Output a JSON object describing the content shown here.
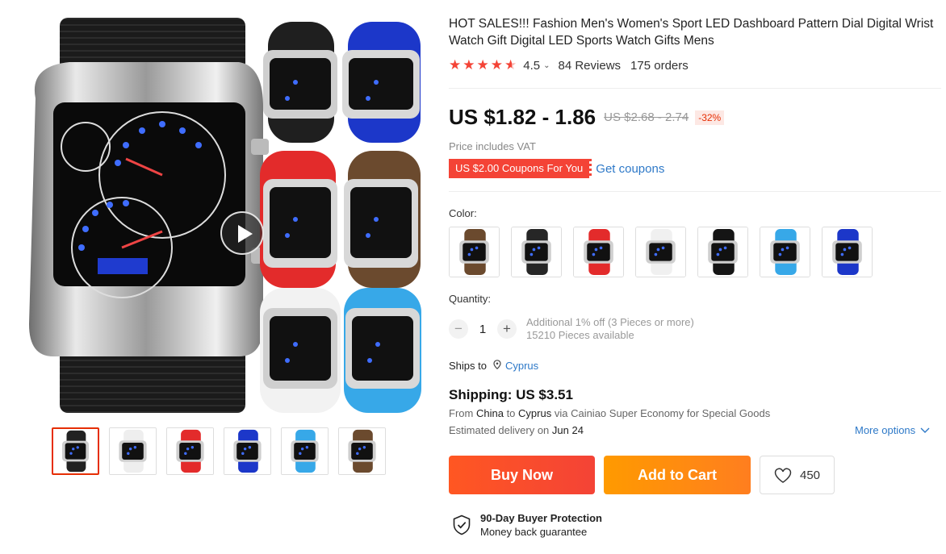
{
  "product": {
    "title": "HOT SALES!!! Fashion Men's Women's Sport LED Dashboard Pattern Dial Digital Wrist Watch Gift Digital LED Sports Watch Gifts Mens",
    "rating_value": "4.5",
    "rating_stars": 4.5,
    "reviews": "84 Reviews",
    "orders": "175 orders"
  },
  "pricing": {
    "price": "US $1.82 - 1.86",
    "original_price": "US $2.68 - 2.74",
    "discount": "-32%",
    "vat_note": "Price includes VAT",
    "coupon": "US $2.00 Coupons For You",
    "get_coupons": "Get coupons"
  },
  "options": {
    "color_label": "Color:",
    "swatches": [
      {
        "name": "brown",
        "strap": "#6b4a2e"
      },
      {
        "name": "black",
        "strap": "#262626"
      },
      {
        "name": "red",
        "strap": "#e32b2b"
      },
      {
        "name": "white",
        "strap": "#f0f0f0"
      },
      {
        "name": "black-2",
        "strap": "#151515"
      },
      {
        "name": "sky-blue",
        "strap": "#37a8e8"
      },
      {
        "name": "blue",
        "strap": "#1c37c9"
      }
    ]
  },
  "quantity": {
    "label": "Quantity:",
    "value": "1",
    "minus": "−",
    "plus": "+",
    "discount_note": "Additional 1% off (3 Pieces or more)",
    "available": "15210 Pieces available"
  },
  "shipping": {
    "ships_to_label": "Ships to",
    "ships_to_country": "Cyprus",
    "cost": "Shipping: US $3.51",
    "from_prefix": "From",
    "from_country": "China",
    "to_word": "to",
    "to_country": "Cyprus",
    "via_text": "via Cainiao Super Economy for Special Goods",
    "delivery_prefix": "Estimated delivery on",
    "delivery_date": "Jun 24",
    "more_options": "More options"
  },
  "actions": {
    "buy_now": "Buy Now",
    "add_to_cart": "Add to Cart",
    "wishlist_count": "450"
  },
  "protection": {
    "title": "90-Day Buyer Protection",
    "subtitle": "Money back guarantee"
  },
  "gallery": {
    "thumbnails": [
      {
        "name": "thumb-main",
        "strap": "#222222"
      },
      {
        "name": "thumb-white",
        "strap": "#eeeeee"
      },
      {
        "name": "thumb-red",
        "strap": "#e32b2b"
      },
      {
        "name": "thumb-blue",
        "strap": "#1c37c9"
      },
      {
        "name": "thumb-sky-blue",
        "strap": "#37a8e8"
      },
      {
        "name": "thumb-brown",
        "strap": "#6b4a2e"
      }
    ],
    "active_index": 0
  },
  "colors": {
    "accent_red": "#f44336",
    "accent_orange": "#ff9a00",
    "link_blue": "#2e79c8"
  }
}
